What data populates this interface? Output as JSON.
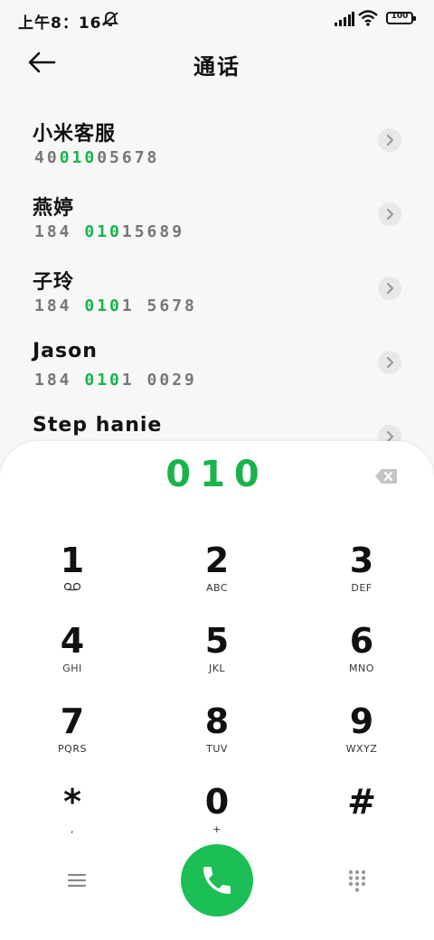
{
  "status": {
    "time": "上午8：16",
    "battery": "100"
  },
  "header": {
    "title": "通话"
  },
  "contacts": [
    {
      "name": "小米客服",
      "num_pre": "40",
      "num_hl": "010",
      "num_post": "05678"
    },
    {
      "name": "燕婷",
      "num_pre": "184 ",
      "num_hl": "010",
      "num_post": "15689"
    },
    {
      "name": "子玲",
      "num_pre": "184 ",
      "num_hl": "010",
      "num_post": "1 5678"
    },
    {
      "name": "Jason",
      "num_pre": "184 ",
      "num_hl": "010",
      "num_post": "1 0029"
    },
    {
      "name": "Step hanie",
      "num_pre": "",
      "num_hl": "",
      "num_post": ""
    }
  ],
  "dialer": {
    "entered": "010",
    "keys": [
      {
        "digit": "1",
        "sub": ""
      },
      {
        "digit": "2",
        "sub": "ABC"
      },
      {
        "digit": "3",
        "sub": "DEF"
      },
      {
        "digit": "4",
        "sub": "GHI"
      },
      {
        "digit": "5",
        "sub": "JKL"
      },
      {
        "digit": "6",
        "sub": "MNO"
      },
      {
        "digit": "7",
        "sub": "PQRS"
      },
      {
        "digit": "8",
        "sub": "TUV"
      },
      {
        "digit": "9",
        "sub": "WXYZ"
      },
      {
        "digit": "*",
        "sub": ","
      },
      {
        "digit": "0",
        "sub": "+"
      },
      {
        "digit": "#",
        "sub": ""
      }
    ]
  },
  "icons": {
    "back": "arrow-left-icon",
    "row_chevron": "chevron-right-icon",
    "backspace": "backspace-icon",
    "menu": "menu-icon",
    "call": "phone-icon",
    "keypad": "keypad-grid-icon",
    "voicemail": "voicemail-icon"
  },
  "colors": {
    "accent": "#19b34b",
    "call_button": "#1bbf55"
  }
}
